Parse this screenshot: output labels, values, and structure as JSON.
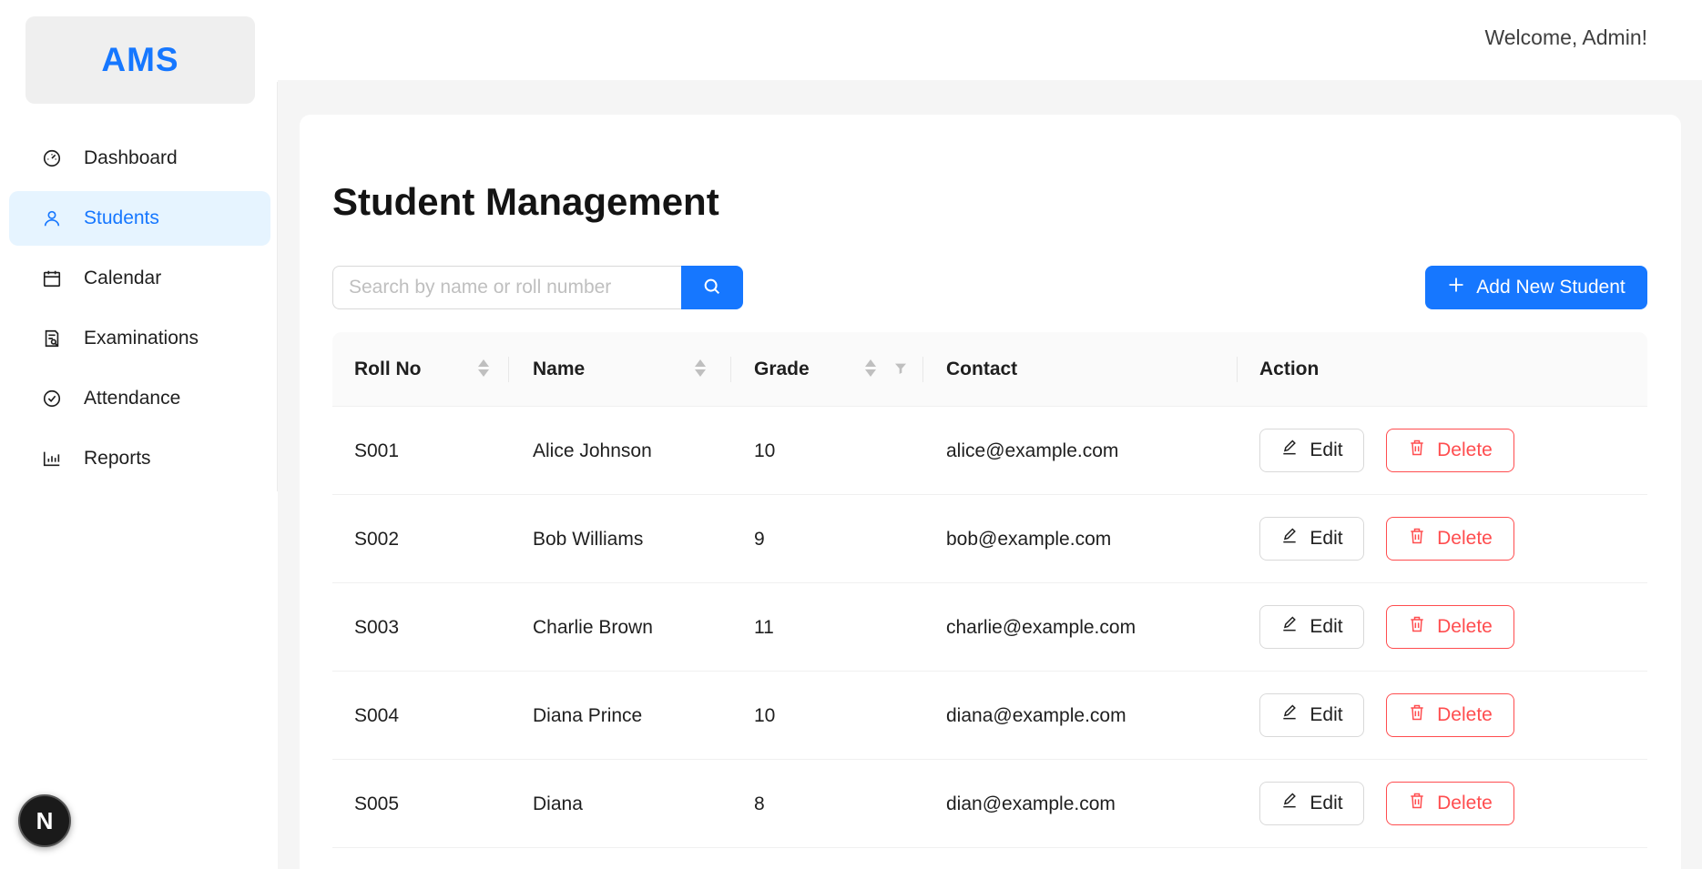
{
  "app": {
    "logo": "AMS"
  },
  "header": {
    "welcome": "Welcome, Admin!"
  },
  "sidebar": {
    "items": [
      {
        "label": "Dashboard",
        "icon": "dashboard-gauge-icon",
        "active": false
      },
      {
        "label": "Students",
        "icon": "user-icon",
        "active": true
      },
      {
        "label": "Calendar",
        "icon": "calendar-icon",
        "active": false
      },
      {
        "label": "Examinations",
        "icon": "file-search-icon",
        "active": false
      },
      {
        "label": "Attendance",
        "icon": "check-circle-icon",
        "active": false
      },
      {
        "label": "Reports",
        "icon": "bar-chart-icon",
        "active": false
      }
    ],
    "floating_badge": "N"
  },
  "main": {
    "title": "Student Management",
    "search": {
      "placeholder": "Search by name or roll number",
      "value": ""
    },
    "add_button": "Add New Student",
    "table": {
      "columns": [
        "Roll No",
        "Name",
        "Grade",
        "Contact",
        "Action"
      ],
      "rows": [
        {
          "roll": "S001",
          "name": "Alice Johnson",
          "grade": "10",
          "contact": "alice@example.com"
        },
        {
          "roll": "S002",
          "name": "Bob Williams",
          "grade": "9",
          "contact": "bob@example.com"
        },
        {
          "roll": "S003",
          "name": "Charlie Brown",
          "grade": "11",
          "contact": "charlie@example.com"
        },
        {
          "roll": "S004",
          "name": "Diana Prince",
          "grade": "10",
          "contact": "diana@example.com"
        },
        {
          "roll": "S005",
          "name": "Diana",
          "grade": "8",
          "contact": "dian@example.com"
        }
      ],
      "edit_label": "Edit",
      "delete_label": "Delete"
    }
  },
  "colors": {
    "primary": "#1677ff",
    "danger": "#ff4d4f",
    "active_bg": "#e6f4ff"
  }
}
